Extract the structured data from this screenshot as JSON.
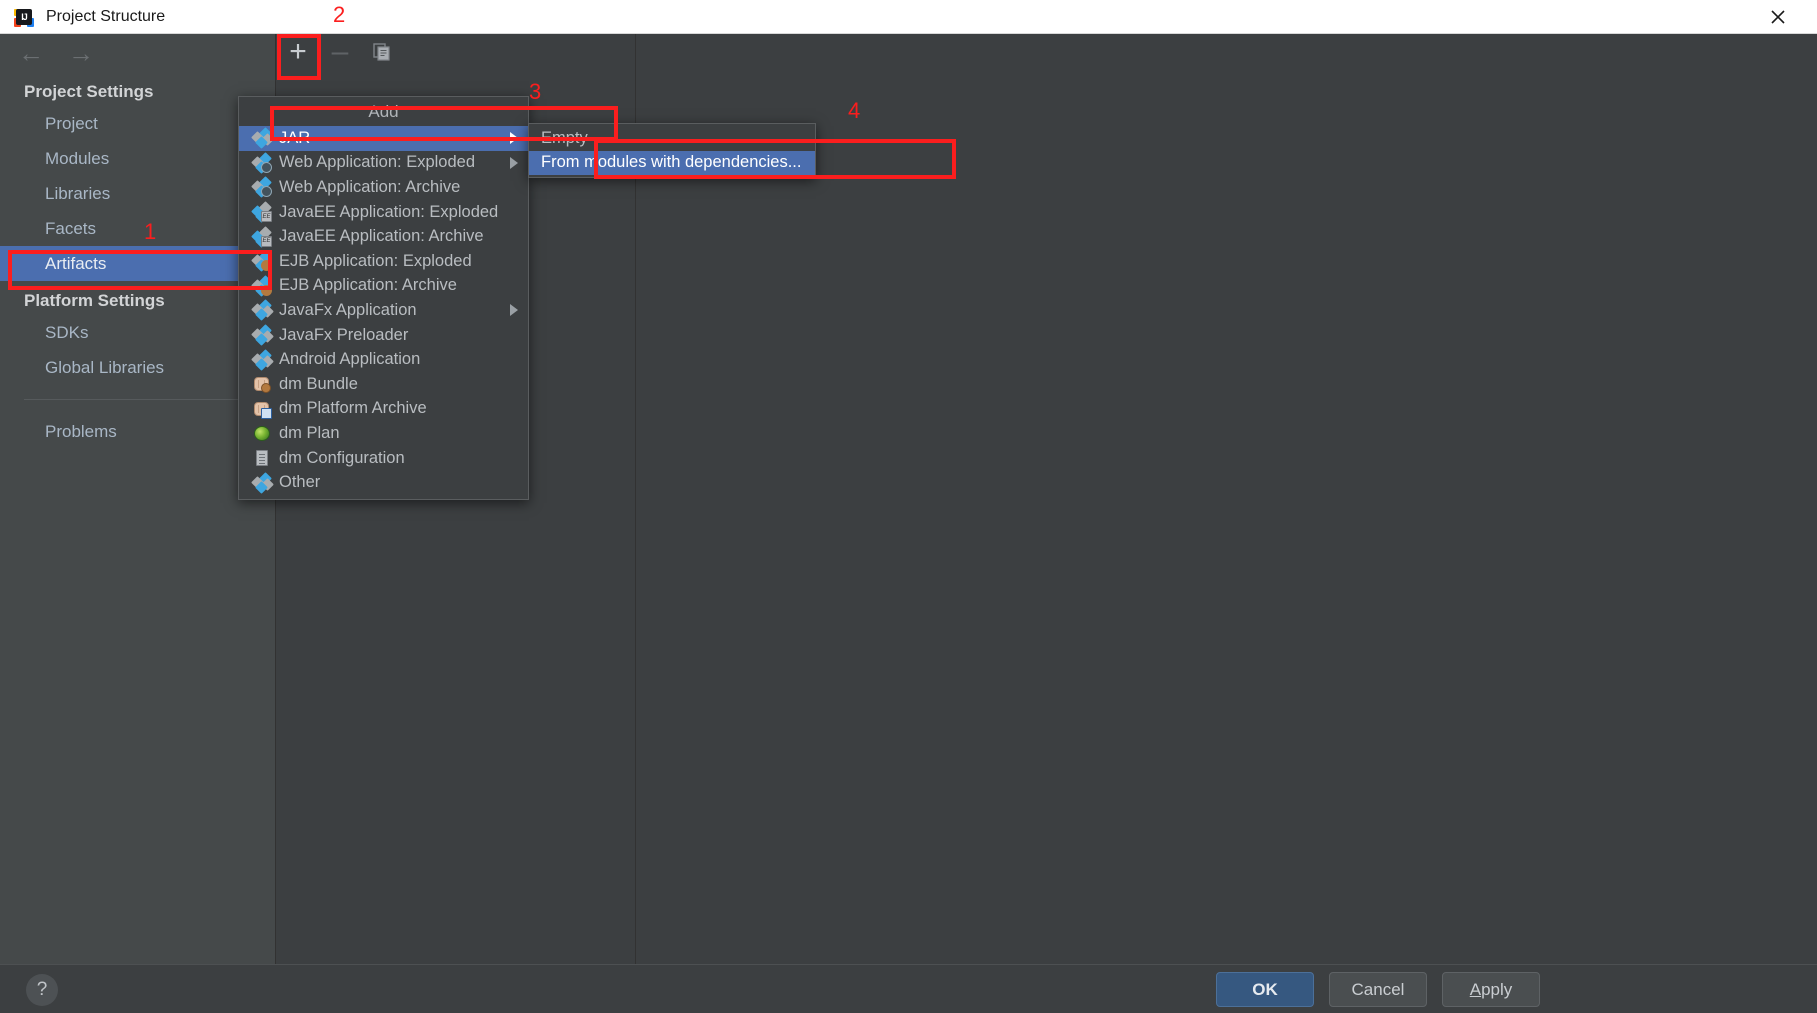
{
  "window": {
    "title": "Project Structure",
    "app_icon": "intellij-idea-icon",
    "close_icon": "close-icon"
  },
  "nav": {
    "back_icon": "arrow-left-icon",
    "forward_icon": "arrow-right-icon"
  },
  "sidebar": {
    "groups": [
      {
        "heading": "Project Settings",
        "items": [
          {
            "label": "Project",
            "selected": false
          },
          {
            "label": "Modules",
            "selected": false
          },
          {
            "label": "Libraries",
            "selected": false
          },
          {
            "label": "Facets",
            "selected": false
          },
          {
            "label": "Artifacts",
            "selected": true
          }
        ]
      },
      {
        "heading": "Platform Settings",
        "items": [
          {
            "label": "SDKs",
            "selected": false
          },
          {
            "label": "Global Libraries",
            "selected": false
          }
        ]
      }
    ],
    "extra_items": [
      {
        "label": "Problems",
        "selected": false
      }
    ]
  },
  "toolbar": {
    "add_label": "+",
    "remove_label": "–",
    "copy_icon": "copy-icon"
  },
  "add_menu": {
    "title": "Add",
    "items": [
      {
        "label": "JAR",
        "icon": "jar-icon",
        "selected": true,
        "submenu": true
      },
      {
        "label": "Web Application: Exploded",
        "icon": "web-application-icon",
        "selected": false,
        "submenu": true
      },
      {
        "label": "Web Application: Archive",
        "icon": "web-application-icon",
        "selected": false,
        "submenu": false
      },
      {
        "label": "JavaEE Application: Exploded",
        "icon": "javaee-application-icon",
        "selected": false,
        "submenu": false
      },
      {
        "label": "JavaEE Application: Archive",
        "icon": "javaee-application-icon",
        "selected": false,
        "submenu": false
      },
      {
        "label": "EJB Application: Exploded",
        "icon": "ejb-application-icon",
        "selected": false,
        "submenu": false
      },
      {
        "label": "EJB Application: Archive",
        "icon": "ejb-application-icon",
        "selected": false,
        "submenu": false
      },
      {
        "label": "JavaFx Application",
        "icon": "javafx-icon",
        "selected": false,
        "submenu": false
      },
      {
        "label": "JavaFx Preloader",
        "icon": "javafx-icon",
        "selected": false,
        "submenu": false
      },
      {
        "label": "Android Application",
        "icon": "android-application-icon",
        "selected": false,
        "submenu": false
      },
      {
        "label": "dm Bundle",
        "icon": "dm-bundle-icon",
        "selected": false,
        "submenu": false
      },
      {
        "label": "dm Platform Archive",
        "icon": "dm-platform-archive-icon",
        "selected": false,
        "submenu": false
      },
      {
        "label": "dm Plan",
        "icon": "dm-plan-icon",
        "selected": false,
        "submenu": false
      },
      {
        "label": "dm Configuration",
        "icon": "dm-configuration-icon",
        "selected": false,
        "submenu": false
      },
      {
        "label": "Other",
        "icon": "other-icon",
        "selected": false,
        "submenu": false
      }
    ]
  },
  "jar_submenu": {
    "items": [
      {
        "label": "Empty",
        "selected": false
      },
      {
        "label": "From modules with dependencies...",
        "selected": true
      }
    ]
  },
  "bottom_bar": {
    "help_label": "?",
    "ok_label": "OK",
    "cancel_label": "Cancel",
    "apply_label_prefix": "A",
    "apply_label_rest": "pply"
  },
  "annotations": [
    {
      "number": "1",
      "target": "sidebar-item-artifacts"
    },
    {
      "number": "2",
      "target": "add-button"
    },
    {
      "number": "3",
      "target": "menu-item-jar"
    },
    {
      "number": "4",
      "target": "submenu-item-from-modules-with-dependencies"
    }
  ],
  "colors": {
    "accent_selection": "#4b6eaf",
    "annotation_red": "#fb1e1e",
    "dialog_bg": "#3c3f41",
    "sidebar_bg": "#45494a",
    "primary_button": "#365880"
  }
}
